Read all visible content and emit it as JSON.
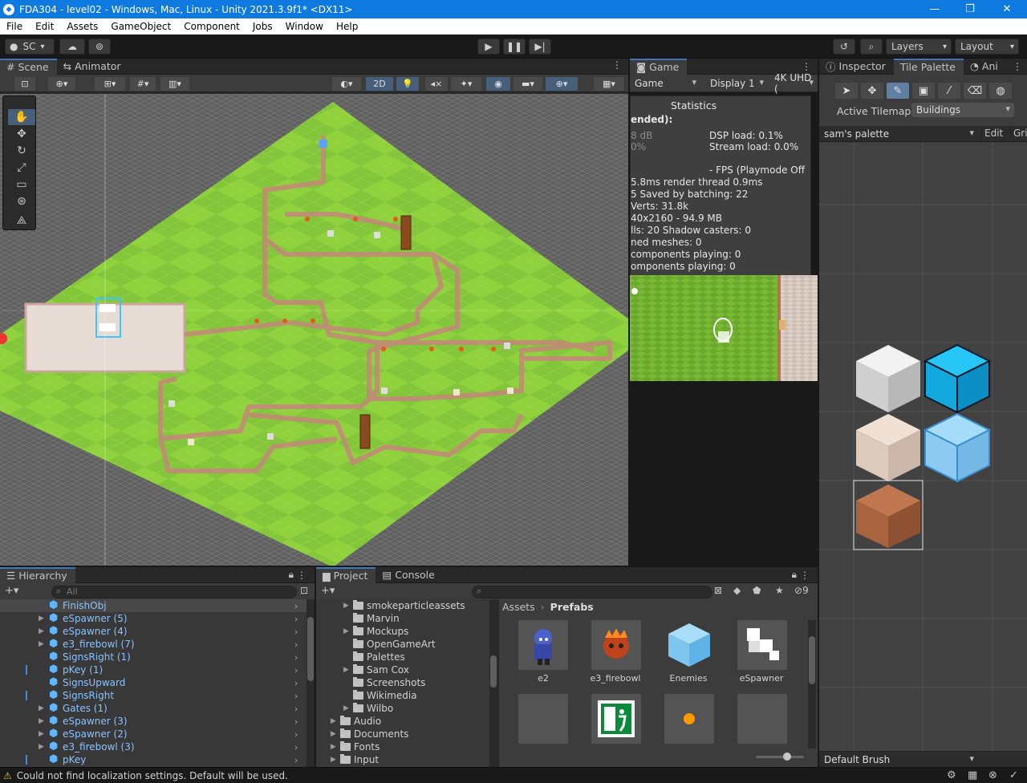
{
  "window": {
    "title": "FDA304 - level02 - Windows, Mac, Linux - Unity 2021.3.9f1* <DX11>"
  },
  "menu": [
    "File",
    "Edit",
    "Assets",
    "GameObject",
    "Component",
    "Jobs",
    "Window",
    "Help"
  ],
  "toolbar": {
    "account": "SC",
    "layers": "Layers",
    "layout": "Layout"
  },
  "scene": {
    "tab_scene": "Scene",
    "tab_animator": "Animator",
    "mode_2d": "2D"
  },
  "game": {
    "tab": "Game",
    "view_dropdown": "Game",
    "display": "Display 1",
    "resolution": "4K UHD (",
    "stats": {
      "title": "Statistics",
      "lines": [
        {
          "l": "ended):",
          "r": ""
        },
        {
          "l": "8 dB",
          "r": "DSP load: 0.1%"
        },
        {
          "l": "0%",
          "r": "Stream load: 0.0%"
        },
        {
          "l": "",
          "r": "- FPS (Playmode Off"
        },
        {
          "l": "5.8ms  render thread 0.9ms",
          "r": ""
        },
        {
          "l": "5      Saved by batching: 22",
          "r": ""
        },
        {
          "l": "         Verts: 31.8k",
          "r": ""
        },
        {
          "l": "40x2160 - 94.9 MB",
          "r": ""
        },
        {
          "l": "lls: 20      Shadow casters: 0",
          "r": ""
        },
        {
          "l": "ned meshes: 0",
          "r": ""
        },
        {
          "l": "components playing: 0",
          "r": ""
        },
        {
          "l": "omponents playing: 0",
          "r": ""
        }
      ]
    }
  },
  "inspector": {
    "tab_inspector": "Inspector",
    "tab_tile_palette": "Tile Palette",
    "tab_ani": "Ani",
    "active_tilemap_label": "Active Tilemap",
    "active_tilemap": "Buildings",
    "palette": "sam's palette",
    "edit": "Edit",
    "grid": "Grid",
    "brush": "Default Brush"
  },
  "hierarchy": {
    "tab": "Hierarchy",
    "search_placeholder": "All",
    "items": [
      {
        "name": "FinishObj",
        "expand": false
      },
      {
        "name": "eSpawner (5)",
        "expand": true
      },
      {
        "name": "eSpawner (4)",
        "expand": true
      },
      {
        "name": "e3_firebowl (7)",
        "expand": true
      },
      {
        "name": "SignsRight (1)",
        "expand": false
      },
      {
        "name": "pKey (1)",
        "expand": false
      },
      {
        "name": "SignsUpward",
        "expand": false
      },
      {
        "name": "SignsRight",
        "expand": false
      },
      {
        "name": "Gates (1)",
        "expand": true
      },
      {
        "name": "eSpawner (3)",
        "expand": true
      },
      {
        "name": "eSpawner (2)",
        "expand": true
      },
      {
        "name": "e3_firebowl (3)",
        "expand": true
      },
      {
        "name": "pKey",
        "expand": false
      }
    ]
  },
  "project": {
    "tab_project": "Project",
    "tab_console": "Console",
    "hidden_count": "9",
    "breadcrumb_root": "Assets",
    "breadcrumb_current": "Prefabs",
    "folders": [
      {
        "name": "smokeparticleassets",
        "indent": 2,
        "expand": true
      },
      {
        "name": "Marvin",
        "indent": 2,
        "expand": false
      },
      {
        "name": "Mockups",
        "indent": 2,
        "expand": true
      },
      {
        "name": "OpenGameArt",
        "indent": 2,
        "expand": false
      },
      {
        "name": "Palettes",
        "indent": 2,
        "expand": false
      },
      {
        "name": "Sam Cox",
        "indent": 2,
        "expand": true
      },
      {
        "name": "Screenshots",
        "indent": 2,
        "expand": false
      },
      {
        "name": "Wikimedia",
        "indent": 2,
        "expand": false
      },
      {
        "name": "Wilbo",
        "indent": 2,
        "expand": true
      },
      {
        "name": "Audio",
        "indent": 1,
        "expand": true
      },
      {
        "name": "Documents",
        "indent": 1,
        "expand": true
      },
      {
        "name": "Fonts",
        "indent": 1,
        "expand": true
      },
      {
        "name": "Input",
        "indent": 1,
        "expand": true
      }
    ],
    "assets": [
      "e2",
      "e3_firebowl",
      "Enemies",
      "eSpawner"
    ]
  },
  "status": {
    "message": "Could not find localization settings. Default will be used."
  },
  "colors": {
    "accent": "#0e7adf",
    "grass": "#8ccf3a",
    "path": "#c9a79a",
    "tile_cyan": "#19b6ee",
    "tile_brown": "#b46a45"
  }
}
